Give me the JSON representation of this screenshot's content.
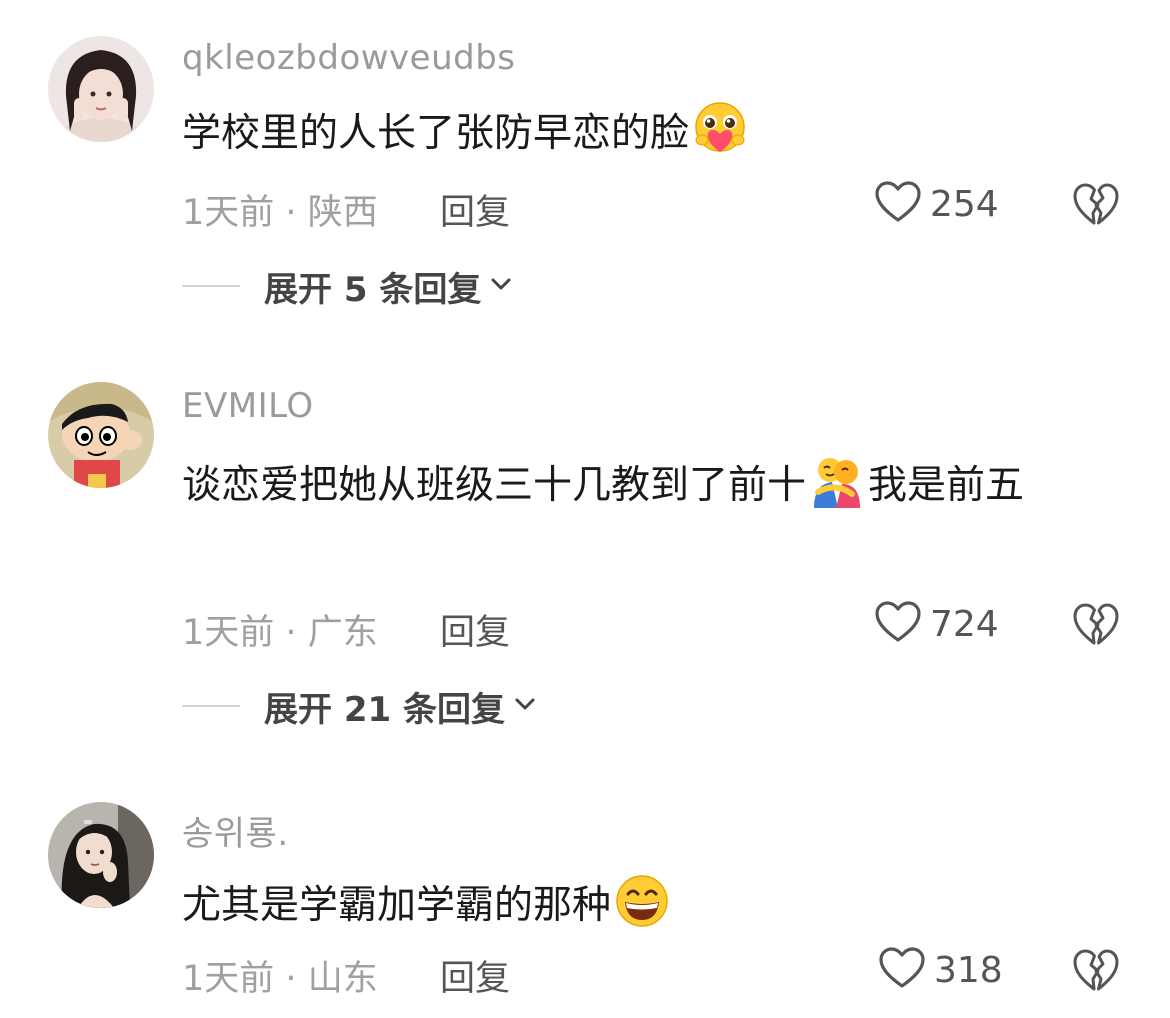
{
  "comments": [
    {
      "username": "qkleozbdowveudbs",
      "text": "学校里的人长了张防早恋的脸",
      "emoji": "pleading-heart-face-emoji",
      "time": "1天前",
      "location": "陕西",
      "reply_label": "回复",
      "likes": "254",
      "expand_label": "展开 5 条回复"
    },
    {
      "username": "EVMILO",
      "text_before": "谈恋爱把她从班级三十几教到了前十",
      "emoji": "people-hugging-emoji",
      "text_after": "我是前五",
      "time": "1天前",
      "location": "广东",
      "reply_label": "回复",
      "likes": "724",
      "expand_label": "展开 21 条回复"
    },
    {
      "username": "송위룡.",
      "text": "尤其是学霸加学霸的那种",
      "emoji": "grinning-face-emoji",
      "time": "1天前",
      "location": "山东",
      "reply_label": "回复",
      "likes": "318"
    }
  ],
  "icons": {
    "like": "heart-outline-icon",
    "dislike": "broken-heart-outline-icon",
    "expand": "chevron-down-icon"
  },
  "colors": {
    "username": "#9a9a9a",
    "text": "#1a1a1a",
    "meta": "#a0a0a0",
    "action": "#555555"
  }
}
